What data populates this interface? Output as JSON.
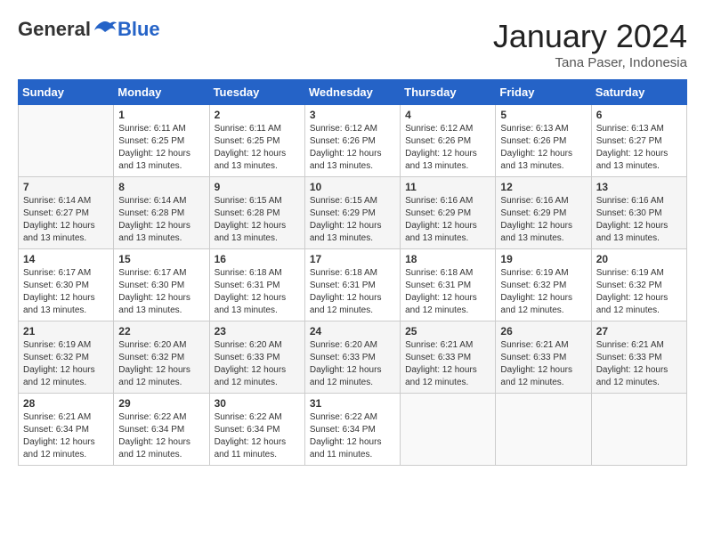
{
  "header": {
    "logo_general": "General",
    "logo_blue": "Blue",
    "month_year": "January 2024",
    "location": "Tana Paser, Indonesia"
  },
  "weekdays": [
    "Sunday",
    "Monday",
    "Tuesday",
    "Wednesday",
    "Thursday",
    "Friday",
    "Saturday"
  ],
  "weeks": [
    [
      {
        "day": "",
        "sunrise": "",
        "sunset": "",
        "daylight": ""
      },
      {
        "day": "1",
        "sunrise": "Sunrise: 6:11 AM",
        "sunset": "Sunset: 6:25 PM",
        "daylight": "Daylight: 12 hours and 13 minutes."
      },
      {
        "day": "2",
        "sunrise": "Sunrise: 6:11 AM",
        "sunset": "Sunset: 6:25 PM",
        "daylight": "Daylight: 12 hours and 13 minutes."
      },
      {
        "day": "3",
        "sunrise": "Sunrise: 6:12 AM",
        "sunset": "Sunset: 6:26 PM",
        "daylight": "Daylight: 12 hours and 13 minutes."
      },
      {
        "day": "4",
        "sunrise": "Sunrise: 6:12 AM",
        "sunset": "Sunset: 6:26 PM",
        "daylight": "Daylight: 12 hours and 13 minutes."
      },
      {
        "day": "5",
        "sunrise": "Sunrise: 6:13 AM",
        "sunset": "Sunset: 6:26 PM",
        "daylight": "Daylight: 12 hours and 13 minutes."
      },
      {
        "day": "6",
        "sunrise": "Sunrise: 6:13 AM",
        "sunset": "Sunset: 6:27 PM",
        "daylight": "Daylight: 12 hours and 13 minutes."
      }
    ],
    [
      {
        "day": "7",
        "sunrise": "Sunrise: 6:14 AM",
        "sunset": "Sunset: 6:27 PM",
        "daylight": "Daylight: 12 hours and 13 minutes."
      },
      {
        "day": "8",
        "sunrise": "Sunrise: 6:14 AM",
        "sunset": "Sunset: 6:28 PM",
        "daylight": "Daylight: 12 hours and 13 minutes."
      },
      {
        "day": "9",
        "sunrise": "Sunrise: 6:15 AM",
        "sunset": "Sunset: 6:28 PM",
        "daylight": "Daylight: 12 hours and 13 minutes."
      },
      {
        "day": "10",
        "sunrise": "Sunrise: 6:15 AM",
        "sunset": "Sunset: 6:29 PM",
        "daylight": "Daylight: 12 hours and 13 minutes."
      },
      {
        "day": "11",
        "sunrise": "Sunrise: 6:16 AM",
        "sunset": "Sunset: 6:29 PM",
        "daylight": "Daylight: 12 hours and 13 minutes."
      },
      {
        "day": "12",
        "sunrise": "Sunrise: 6:16 AM",
        "sunset": "Sunset: 6:29 PM",
        "daylight": "Daylight: 12 hours and 13 minutes."
      },
      {
        "day": "13",
        "sunrise": "Sunrise: 6:16 AM",
        "sunset": "Sunset: 6:30 PM",
        "daylight": "Daylight: 12 hours and 13 minutes."
      }
    ],
    [
      {
        "day": "14",
        "sunrise": "Sunrise: 6:17 AM",
        "sunset": "Sunset: 6:30 PM",
        "daylight": "Daylight: 12 hours and 13 minutes."
      },
      {
        "day": "15",
        "sunrise": "Sunrise: 6:17 AM",
        "sunset": "Sunset: 6:30 PM",
        "daylight": "Daylight: 12 hours and 13 minutes."
      },
      {
        "day": "16",
        "sunrise": "Sunrise: 6:18 AM",
        "sunset": "Sunset: 6:31 PM",
        "daylight": "Daylight: 12 hours and 13 minutes."
      },
      {
        "day": "17",
        "sunrise": "Sunrise: 6:18 AM",
        "sunset": "Sunset: 6:31 PM",
        "daylight": "Daylight: 12 hours and 12 minutes."
      },
      {
        "day": "18",
        "sunrise": "Sunrise: 6:18 AM",
        "sunset": "Sunset: 6:31 PM",
        "daylight": "Daylight: 12 hours and 12 minutes."
      },
      {
        "day": "19",
        "sunrise": "Sunrise: 6:19 AM",
        "sunset": "Sunset: 6:32 PM",
        "daylight": "Daylight: 12 hours and 12 minutes."
      },
      {
        "day": "20",
        "sunrise": "Sunrise: 6:19 AM",
        "sunset": "Sunset: 6:32 PM",
        "daylight": "Daylight: 12 hours and 12 minutes."
      }
    ],
    [
      {
        "day": "21",
        "sunrise": "Sunrise: 6:19 AM",
        "sunset": "Sunset: 6:32 PM",
        "daylight": "Daylight: 12 hours and 12 minutes."
      },
      {
        "day": "22",
        "sunrise": "Sunrise: 6:20 AM",
        "sunset": "Sunset: 6:32 PM",
        "daylight": "Daylight: 12 hours and 12 minutes."
      },
      {
        "day": "23",
        "sunrise": "Sunrise: 6:20 AM",
        "sunset": "Sunset: 6:33 PM",
        "daylight": "Daylight: 12 hours and 12 minutes."
      },
      {
        "day": "24",
        "sunrise": "Sunrise: 6:20 AM",
        "sunset": "Sunset: 6:33 PM",
        "daylight": "Daylight: 12 hours and 12 minutes."
      },
      {
        "day": "25",
        "sunrise": "Sunrise: 6:21 AM",
        "sunset": "Sunset: 6:33 PM",
        "daylight": "Daylight: 12 hours and 12 minutes."
      },
      {
        "day": "26",
        "sunrise": "Sunrise: 6:21 AM",
        "sunset": "Sunset: 6:33 PM",
        "daylight": "Daylight: 12 hours and 12 minutes."
      },
      {
        "day": "27",
        "sunrise": "Sunrise: 6:21 AM",
        "sunset": "Sunset: 6:33 PM",
        "daylight": "Daylight: 12 hours and 12 minutes."
      }
    ],
    [
      {
        "day": "28",
        "sunrise": "Sunrise: 6:21 AM",
        "sunset": "Sunset: 6:34 PM",
        "daylight": "Daylight: 12 hours and 12 minutes."
      },
      {
        "day": "29",
        "sunrise": "Sunrise: 6:22 AM",
        "sunset": "Sunset: 6:34 PM",
        "daylight": "Daylight: 12 hours and 12 minutes."
      },
      {
        "day": "30",
        "sunrise": "Sunrise: 6:22 AM",
        "sunset": "Sunset: 6:34 PM",
        "daylight": "Daylight: 12 hours and 11 minutes."
      },
      {
        "day": "31",
        "sunrise": "Sunrise: 6:22 AM",
        "sunset": "Sunset: 6:34 PM",
        "daylight": "Daylight: 12 hours and 11 minutes."
      },
      {
        "day": "",
        "sunrise": "",
        "sunset": "",
        "daylight": ""
      },
      {
        "day": "",
        "sunrise": "",
        "sunset": "",
        "daylight": ""
      },
      {
        "day": "",
        "sunrise": "",
        "sunset": "",
        "daylight": ""
      }
    ]
  ]
}
